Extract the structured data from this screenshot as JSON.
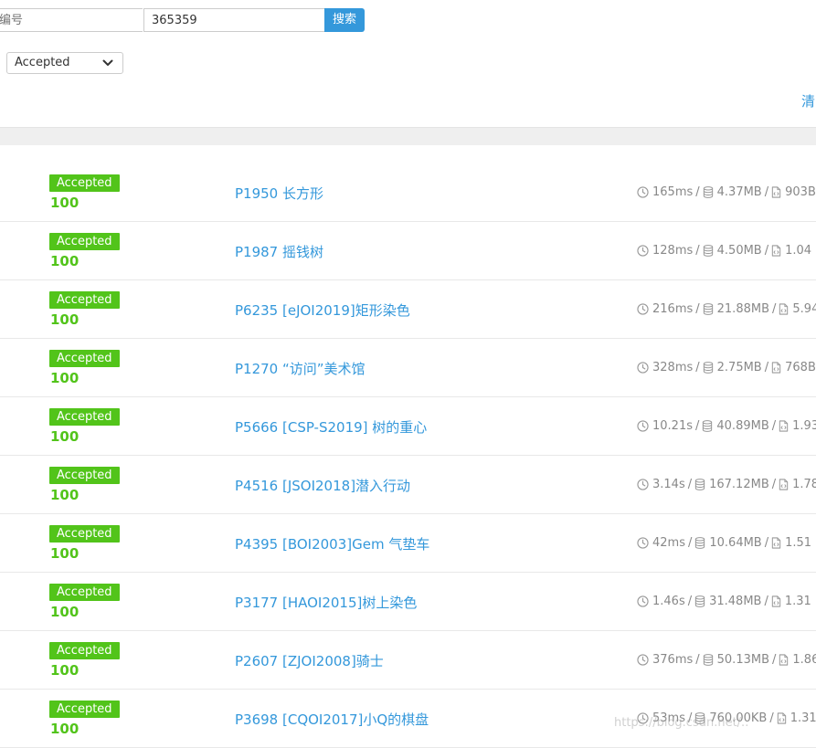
{
  "search": {
    "user_placeholder": "编号",
    "problem_value": "365359",
    "button_label": "搜索"
  },
  "filter": {
    "status_selected": "Accepted"
  },
  "clear_label": "清",
  "records": [
    {
      "status": "Accepted",
      "score": "100",
      "problem": "P1950 长方形",
      "time": "165ms",
      "memory": "4.37MB",
      "code": "903B"
    },
    {
      "status": "Accepted",
      "score": "100",
      "problem": "P1987 摇钱树",
      "time": "128ms",
      "memory": "4.50MB",
      "code": "1.04"
    },
    {
      "status": "Accepted",
      "score": "100",
      "problem": "P6235 [eJOI2019]矩形染色",
      "time": "216ms",
      "memory": "21.88MB",
      "code": "5.94"
    },
    {
      "status": "Accepted",
      "score": "100",
      "problem": "P1270 “访问”美术馆",
      "time": "328ms",
      "memory": "2.75MB",
      "code": "768B"
    },
    {
      "status": "Accepted",
      "score": "100",
      "problem": "P5666 [CSP-S2019] 树的重心",
      "time": "10.21s",
      "memory": "40.89MB",
      "code": "1.93"
    },
    {
      "status": "Accepted",
      "score": "100",
      "problem": "P4516 [JSOI2018]潜入行动",
      "time": "3.14s",
      "memory": "167.12MB",
      "code": "1.78"
    },
    {
      "status": "Accepted",
      "score": "100",
      "problem": "P4395 [BOI2003]Gem 气垫车",
      "time": "42ms",
      "memory": "10.64MB",
      "code": "1.51"
    },
    {
      "status": "Accepted",
      "score": "100",
      "problem": "P3177 [HAOI2015]树上染色",
      "time": "1.46s",
      "memory": "31.48MB",
      "code": "1.31"
    },
    {
      "status": "Accepted",
      "score": "100",
      "problem": "P2607 [ZJOI2008]骑士",
      "time": "376ms",
      "memory": "50.13MB",
      "code": "1.86"
    },
    {
      "status": "Accepted",
      "score": "100",
      "problem": "P3698 [CQOI2017]小Q的棋盘",
      "time": "53ms",
      "memory": "760.00KB",
      "code": "1.31"
    }
  ],
  "icons": {
    "time": "clock-icon",
    "memory": "database-icon",
    "code": "file-code-icon",
    "select": "chevron-down-icon"
  },
  "colors": {
    "accent": "#3498db",
    "accepted": "#52c41a",
    "muted": "#888888"
  },
  "watermark": "https://blog.csdn.net/.."
}
